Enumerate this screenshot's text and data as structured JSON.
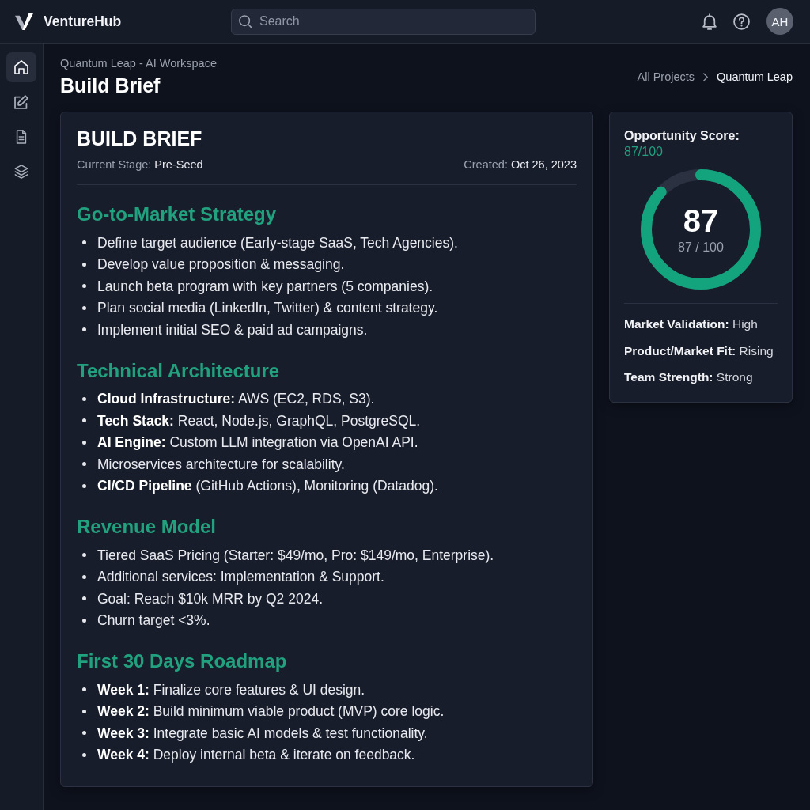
{
  "app": {
    "name": "VentureHub"
  },
  "search": {
    "placeholder": "Search"
  },
  "user": {
    "initials": "AH"
  },
  "sidebar": {
    "items": [
      {
        "kind": "home",
        "selected": true
      },
      {
        "kind": "edit",
        "selected": false
      },
      {
        "kind": "document",
        "selected": false
      },
      {
        "kind": "layers",
        "selected": false
      }
    ]
  },
  "page": {
    "subtitle": "Quantum Leap - AI Workspace",
    "title": "Build Brief"
  },
  "breadcrumb": [
    {
      "label": "All Projects",
      "current": false
    },
    {
      "label": "Quantum Leap",
      "current": true
    }
  ],
  "brief": {
    "title": "BUILD BRIEF",
    "stage": {
      "label": "Current Stage:",
      "value": "Pre-Seed"
    },
    "created": {
      "label": "Created:",
      "value": "Oct 26, 2023"
    },
    "sections": [
      {
        "heading": "Go-to-Market Strategy",
        "items": [
          "Define target audience (Early-stage SaaS, Tech Agencies).",
          "Develop value proposition & messaging.",
          "Launch beta program with key partners (5 companies).",
          "Plan social media (LinkedIn, Twitter) & content strategy.",
          "Implement initial SEO & paid ad campaigns."
        ]
      },
      {
        "heading": "Technical Architecture",
        "items": [
          "**Cloud Infrastructure:** AWS (EC2, RDS, S3).",
          "**Tech Stack:** React, Node.js, GraphQL, PostgreSQL.",
          "**AI Engine:** Custom LLM integration via OpenAI API.",
          "Microservices architecture for scalability.",
          "**CI/CD Pipeline** (GitHub Actions), Monitoring (Datadog)."
        ]
      },
      {
        "heading": "Revenue Model",
        "items": [
          "Tiered SaaS Pricing (Starter: $49/mo, Pro: $149/mo, Enterprise).",
          "Additional services: Implementation & Support.",
          "Goal: Reach $10k MRR by Q2 2024.",
          "Churn target <3%."
        ]
      },
      {
        "heading": "First 30 Days Roadmap",
        "items": [
          "**Week 1:** Finalize core features & UI design.",
          "**Week 2:** Build minimum viable product (MVP) core logic.",
          "**Week 3:** Integrate basic AI models & test functionality.",
          "**Week 4:** Deploy internal beta & iterate on feedback."
        ]
      }
    ]
  },
  "score": {
    "label": "Opportunity Score:",
    "value": "87/100",
    "level": 0.87,
    "number": "87",
    "caption": "87 / 100",
    "metrics": [
      {
        "label": "Market Validation:",
        "value": "High"
      },
      {
        "label": "Product/Market Fit:",
        "value": "Rising"
      },
      {
        "label": "Team Strength:",
        "value": "Strong"
      }
    ]
  }
}
